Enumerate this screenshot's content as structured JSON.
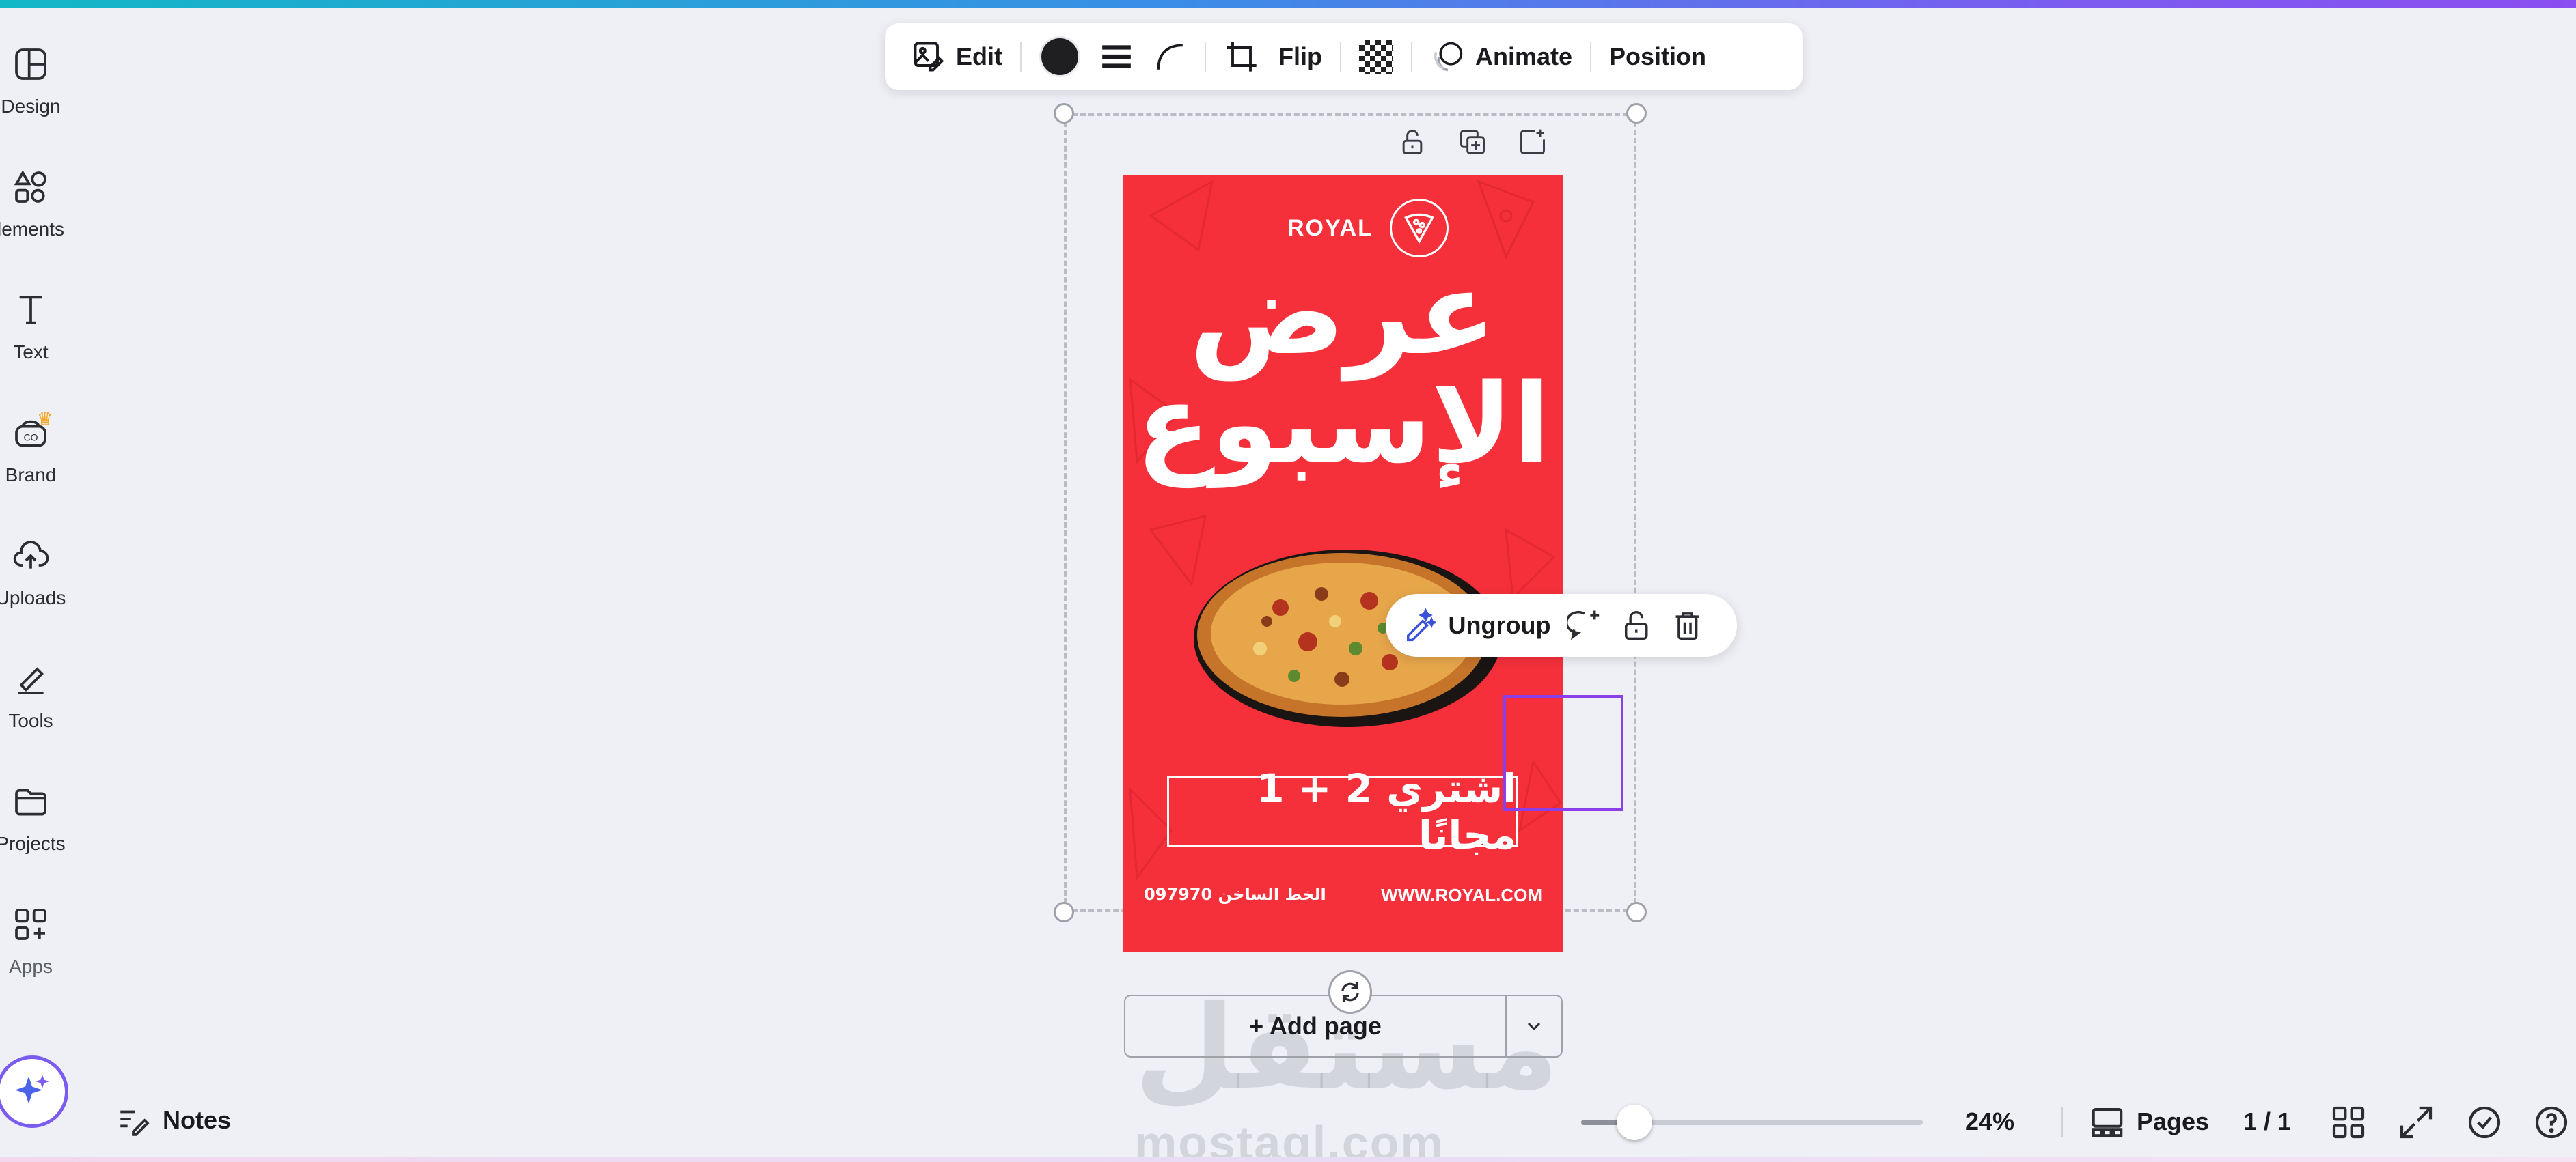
{
  "rail": {
    "items": [
      {
        "label": "Design"
      },
      {
        "label": "lements"
      },
      {
        "label": "Text"
      },
      {
        "label": "Brand"
      },
      {
        "label": "Uploads"
      },
      {
        "label": "Tools"
      },
      {
        "label": "Projects"
      },
      {
        "label": "Apps"
      }
    ]
  },
  "toolbar": {
    "edit_label": "Edit",
    "flip_label": "Flip",
    "animate_label": "Animate",
    "position_label": "Position",
    "color_value": "#1f1f22"
  },
  "poster": {
    "brand": "ROYAL",
    "headline_line1": "عرض",
    "headline_line2": "الإسبوع",
    "offer": "اشتري 2 + 1 مجانًا",
    "footer_phone": "097970 الخط الساخن",
    "footer_url": "WWW.ROYAL.COM",
    "bg_color": "#f5303a"
  },
  "context_toolbar": {
    "ungroup_label": "Ungroup"
  },
  "add_page": {
    "label": "+ Add page"
  },
  "watermark": {
    "arabic": "مستقل",
    "latin": "mostaql.com"
  },
  "bottom_bar": {
    "notes_label": "Notes",
    "zoom": "24%",
    "zoom_value": 24,
    "pages_label": "Pages",
    "page_count": "1 / 1"
  },
  "colors": {
    "accent": "#8b3fe8",
    "canvas_bg": "#eef0f5"
  }
}
